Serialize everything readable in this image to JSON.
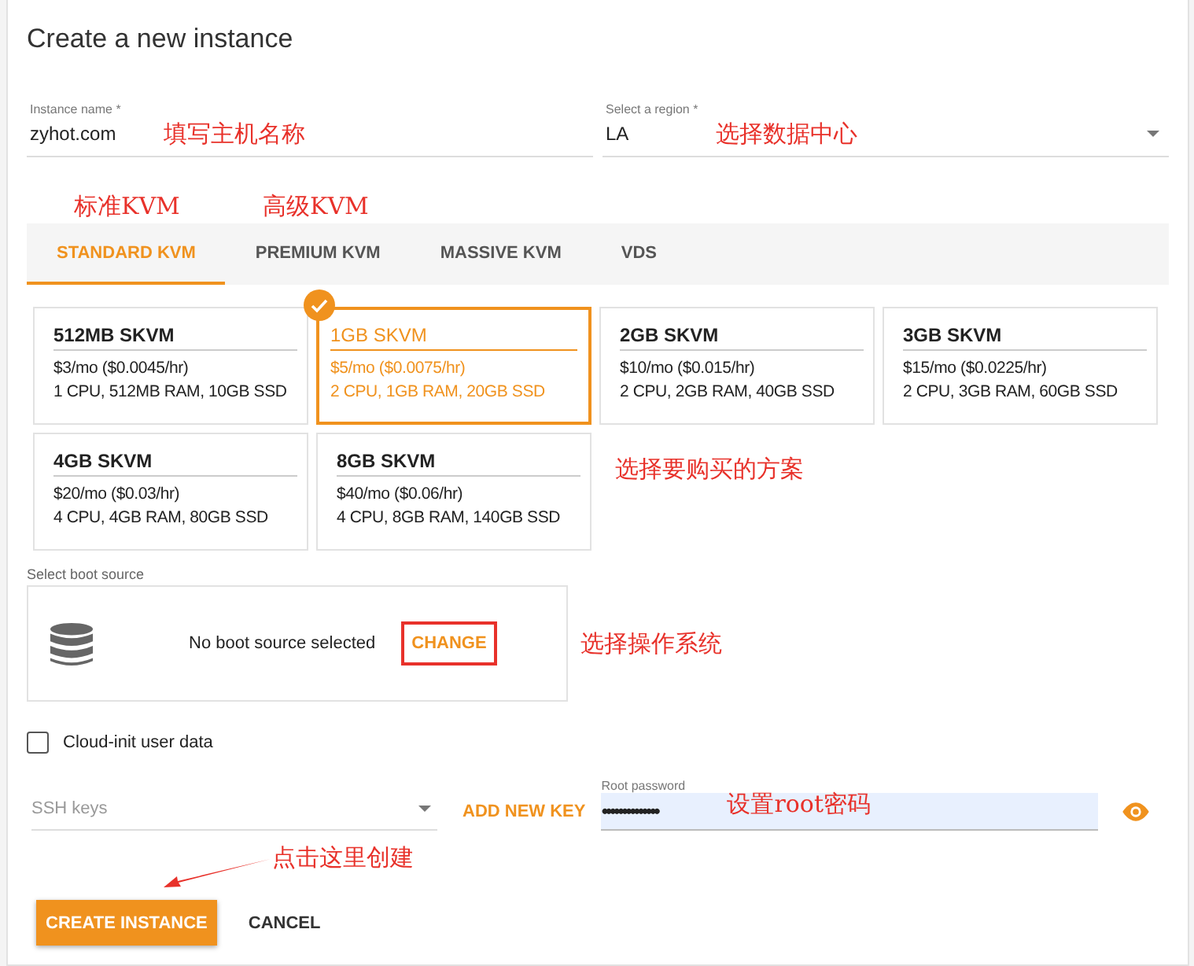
{
  "title": "Create a new instance",
  "name_field": {
    "label": "Instance name *",
    "value": "zyhot.com",
    "annotation": "填写主机名称"
  },
  "region_field": {
    "label": "Select a region *",
    "value": "LA",
    "annotation": "选择数据中心"
  },
  "tabs": [
    {
      "label": "STANDARD KVM",
      "selected": true,
      "annotation": "标准KVM"
    },
    {
      "label": "PREMIUM KVM",
      "selected": false,
      "annotation": "高级KVM"
    },
    {
      "label": "MASSIVE KVM",
      "selected": false
    },
    {
      "label": "VDS",
      "selected": false
    }
  ],
  "plans": [
    {
      "name": "512MB SKVM",
      "price": "$3/mo ($0.0045/hr)",
      "specs": "1 CPU, 512MB RAM, 10GB SSD",
      "selected": false
    },
    {
      "name": "1GB SKVM",
      "price": "$5/mo ($0.0075/hr)",
      "specs": "2 CPU, 1GB RAM, 20GB SSD",
      "selected": true
    },
    {
      "name": "2GB SKVM",
      "price": "$10/mo ($0.015/hr)",
      "specs": "2 CPU, 2GB RAM, 40GB SSD",
      "selected": false
    },
    {
      "name": "3GB SKVM",
      "price": "$15/mo ($0.0225/hr)",
      "specs": "2 CPU, 3GB RAM, 60GB SSD",
      "selected": false
    },
    {
      "name": "4GB SKVM",
      "price": "$20/mo ($0.03/hr)",
      "specs": "4 CPU, 4GB RAM, 80GB SSD",
      "selected": false
    },
    {
      "name": "8GB SKVM",
      "price": "$40/mo ($0.06/hr)",
      "specs": "4 CPU, 8GB RAM, 140GB SSD",
      "selected": false
    }
  ],
  "plans_annotation": "选择要购买的方案",
  "boot": {
    "label": "Select boot source",
    "status": "No boot source selected",
    "button": "CHANGE",
    "annotation": "选择操作系统"
  },
  "cloud_init": {
    "label": "Cloud-init user data",
    "checked": false
  },
  "ssh_keys": {
    "placeholder": "SSH keys"
  },
  "add_key": "ADD NEW KEY",
  "password": {
    "label": "Root password",
    "value": "••••••••••••••",
    "annotation": "设置root密码"
  },
  "create_annotation": "点击这里创建",
  "buttons": {
    "create": "CREATE INSTANCE",
    "cancel": "CANCEL"
  }
}
